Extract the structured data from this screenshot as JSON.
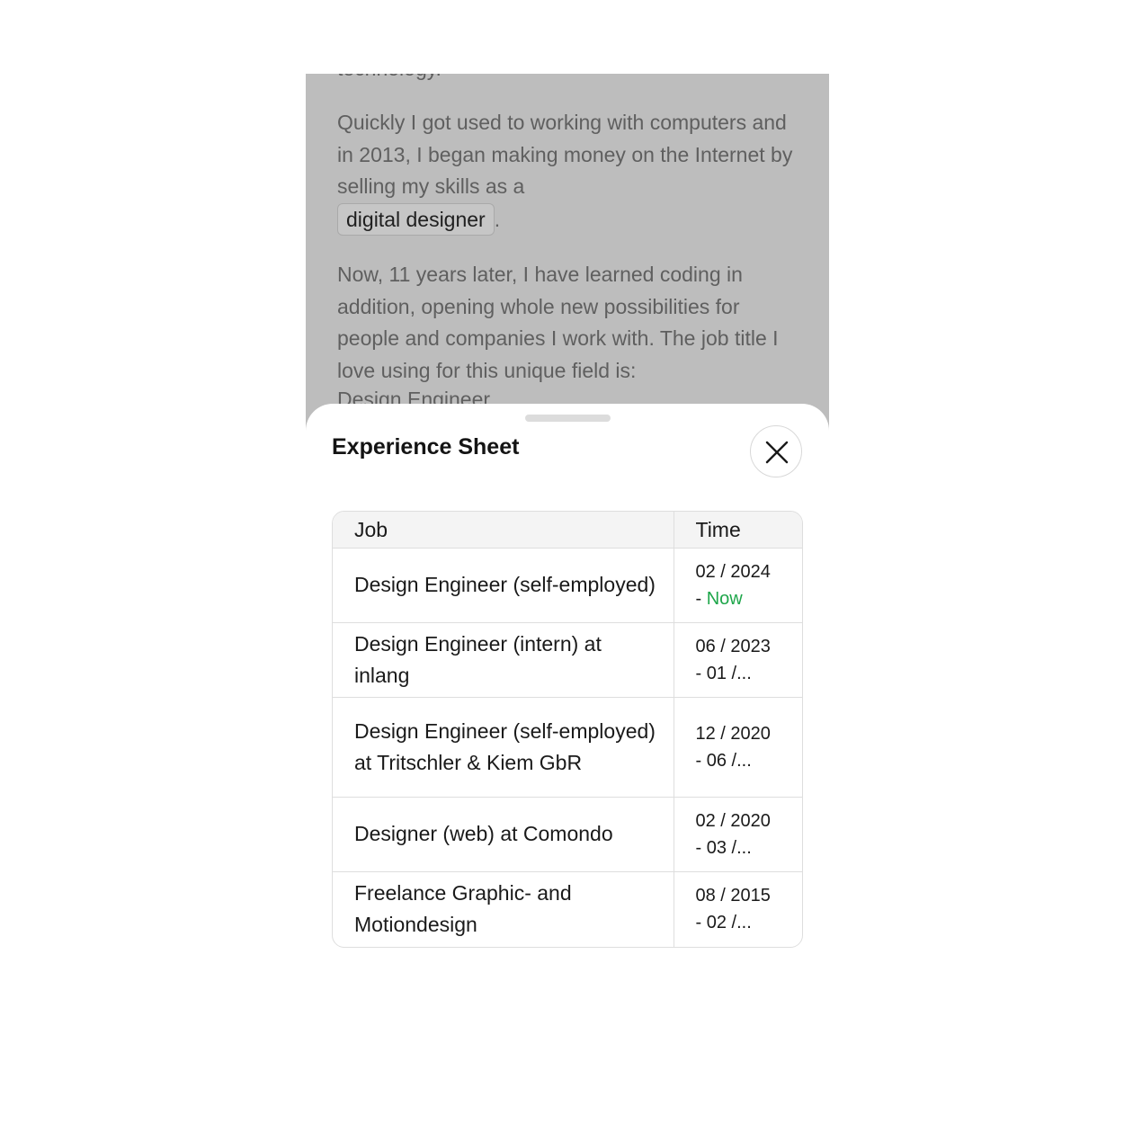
{
  "background": {
    "cut_top": "technology.",
    "paragraph1_text": "Quickly I got used to working with computers and in 2013, I began making money on the Internet by selling my skills as a",
    "paragraph1_chip": "digital designer",
    "paragraph1_end": ".",
    "paragraph2_text": "Now, 11 years later, I have learned coding in addition, opening whole new possibilities for people and companies I work with. The job title I love using for this unique field is:",
    "cut_bottom": "Design Engineer"
  },
  "sheet": {
    "title": "Experience Sheet",
    "close_icon": "close-icon",
    "table": {
      "headers": {
        "job": "Job",
        "time": "Time"
      },
      "rows": [
        {
          "job": "Design Engineer (self-employed)",
          "start": "02 / 2024",
          "end_prefix": "- ",
          "end": "Now"
        },
        {
          "job": "Design Engineer (intern) at inlang",
          "start": "06 / 2023",
          "end_prefix": "- ",
          "end": "01 /..."
        },
        {
          "job": "Design Engineer (self-employed) at Tritschler & Kiem GbR",
          "start": "12 / 2020",
          "end_prefix": "- ",
          "end": "06 /..."
        },
        {
          "job": "Designer (web) at Comondo",
          "start": "02 / 2020",
          "end_prefix": "- ",
          "end": "03 /..."
        },
        {
          "job": "Freelance Graphic- and Motiondesign",
          "start": "08 / 2015",
          "end_prefix": "- ",
          "end": "02 /..."
        }
      ]
    }
  },
  "colors": {
    "backdrop": "#bdbdbd",
    "now_accent": "#1ea64a"
  }
}
